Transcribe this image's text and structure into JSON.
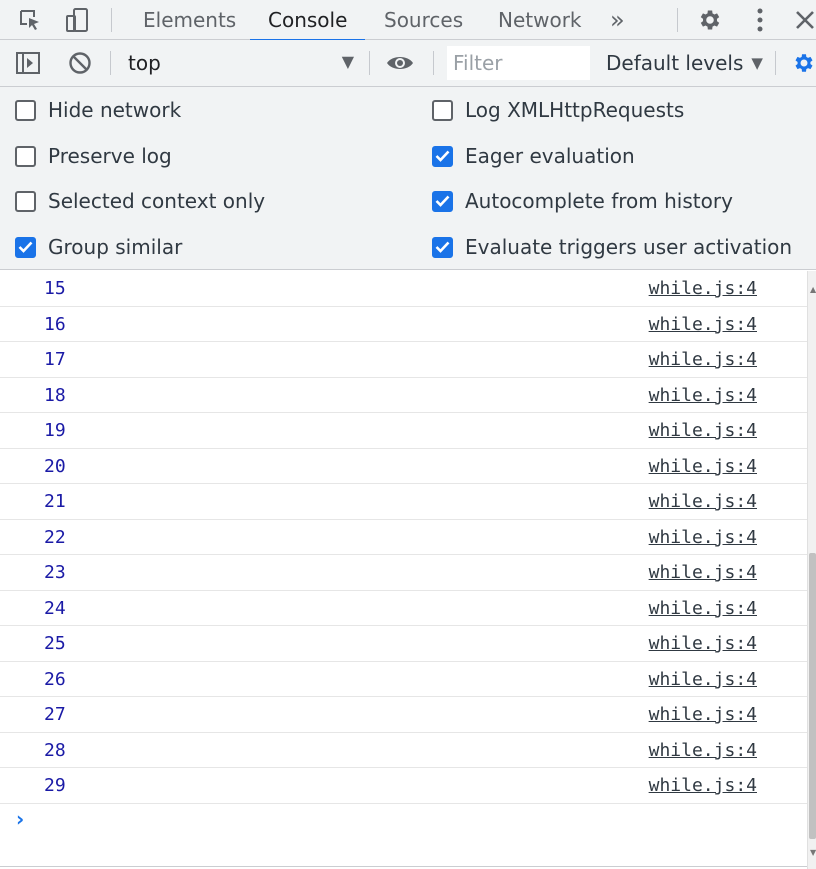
{
  "tabs": [
    {
      "label": "Elements",
      "active": false
    },
    {
      "label": "Console",
      "active": true
    },
    {
      "label": "Sources",
      "active": false
    },
    {
      "label": "Network",
      "active": false
    }
  ],
  "tabs_overflow_label": "»",
  "toolbar": {
    "context": "top",
    "filter_placeholder": "Filter",
    "levels_label": "Default levels"
  },
  "settings": {
    "left": [
      {
        "label": "Hide network",
        "checked": false
      },
      {
        "label": "Preserve log",
        "checked": false
      },
      {
        "label": "Selected context only",
        "checked": false
      },
      {
        "label": "Group similar",
        "checked": true
      }
    ],
    "right": [
      {
        "label": "Log XMLHttpRequests",
        "checked": false
      },
      {
        "label": "Eager evaluation",
        "checked": true
      },
      {
        "label": "Autocomplete from history",
        "checked": true
      },
      {
        "label": "Evaluate triggers user activation",
        "checked": true
      }
    ]
  },
  "messages": [
    {
      "value": "15",
      "source": "while.js:4"
    },
    {
      "value": "16",
      "source": "while.js:4"
    },
    {
      "value": "17",
      "source": "while.js:4"
    },
    {
      "value": "18",
      "source": "while.js:4"
    },
    {
      "value": "19",
      "source": "while.js:4"
    },
    {
      "value": "20",
      "source": "while.js:4"
    },
    {
      "value": "21",
      "source": "while.js:4"
    },
    {
      "value": "22",
      "source": "while.js:4"
    },
    {
      "value": "23",
      "source": "while.js:4"
    },
    {
      "value": "24",
      "source": "while.js:4"
    },
    {
      "value": "25",
      "source": "while.js:4"
    },
    {
      "value": "26",
      "source": "while.js:4"
    },
    {
      "value": "27",
      "source": "while.js:4"
    },
    {
      "value": "28",
      "source": "while.js:4"
    },
    {
      "value": "29",
      "source": "while.js:4"
    }
  ],
  "prompt_symbol": "›",
  "colors": {
    "accent": "#1a73e8",
    "number": "#1a1aa6",
    "toolbar_bg": "#f1f3f4"
  },
  "icons": [
    "inspect-icon",
    "device-toggle-icon",
    "gear-icon",
    "kebab-menu-icon",
    "close-icon",
    "sidebar-toggle-icon",
    "clear-console-icon",
    "eye-icon",
    "settings-gear-icon"
  ]
}
